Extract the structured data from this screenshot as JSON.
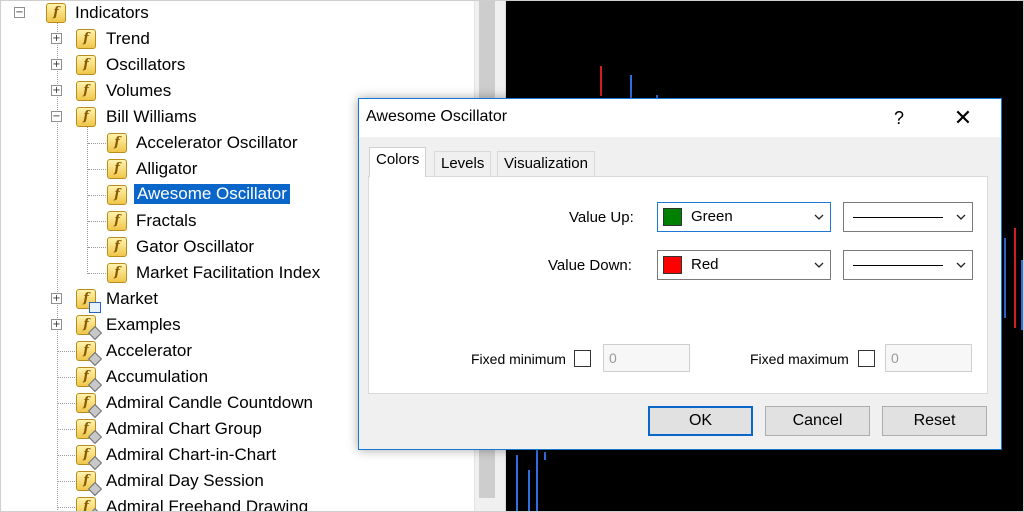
{
  "navigator": {
    "items": [
      {
        "label": "Indicators",
        "icon": "indicator-folder-icon"
      },
      {
        "label": "Trend",
        "icon": "indicator-folder-icon"
      },
      {
        "label": "Oscillators",
        "icon": "indicator-folder-icon"
      },
      {
        "label": "Volumes",
        "icon": "indicator-folder-icon"
      },
      {
        "label": "Bill Williams",
        "icon": "indicator-folder-icon"
      },
      {
        "label": "Accelerator Oscillator",
        "icon": "indicator-icon"
      },
      {
        "label": "Alligator",
        "icon": "indicator-icon"
      },
      {
        "label": "Awesome Oscillator",
        "icon": "indicator-icon",
        "selected": true
      },
      {
        "label": "Fractals",
        "icon": "indicator-icon"
      },
      {
        "label": "Gator Oscillator",
        "icon": "indicator-icon"
      },
      {
        "label": "Market Facilitation Index",
        "icon": "indicator-icon"
      },
      {
        "label": "Market",
        "icon": "market-indicator-icon"
      },
      {
        "label": "Examples",
        "icon": "custom-indicator-icon"
      },
      {
        "label": "Accelerator",
        "icon": "custom-indicator-icon"
      },
      {
        "label": "Accumulation",
        "icon": "custom-indicator-icon"
      },
      {
        "label": "Admiral Candle Countdown",
        "icon": "custom-indicator-icon"
      },
      {
        "label": "Admiral Chart Group",
        "icon": "custom-indicator-icon"
      },
      {
        "label": "Admiral Chart-in-Chart",
        "icon": "custom-indicator-icon"
      },
      {
        "label": "Admiral Day Session",
        "icon": "custom-indicator-icon"
      },
      {
        "label": "Admiral Freehand Drawing",
        "icon": "custom-indicator-icon"
      }
    ],
    "expander_collapsed": "+",
    "expander_expanded": "−",
    "icon_glyph": "f"
  },
  "dialog": {
    "title": "Awesome Oscillator",
    "help_glyph": "?",
    "close_glyph": "✕",
    "tabs": [
      {
        "label": "Colors",
        "active": true
      },
      {
        "label": "Levels",
        "active": false
      },
      {
        "label": "Visualization",
        "active": false
      }
    ],
    "value_up": {
      "label": "Value Up:",
      "color_name": "Green",
      "color": "#008000"
    },
    "value_down": {
      "label": "Value Down:",
      "color_name": "Red",
      "color": "#ff0000"
    },
    "fixed_minimum": {
      "label": "Fixed minimum",
      "checked": false,
      "value": "0"
    },
    "fixed_maximum": {
      "label": "Fixed maximum",
      "checked": false,
      "value": "0"
    },
    "buttons": {
      "ok": "OK",
      "cancel": "Cancel",
      "reset": "Reset"
    }
  },
  "colors": {
    "selection": "#0a67c9",
    "dialog_border": "#1778d4",
    "chart_background": "#000000",
    "candle_up": "#2f6fe0",
    "candle_down": "#d41f1f"
  }
}
